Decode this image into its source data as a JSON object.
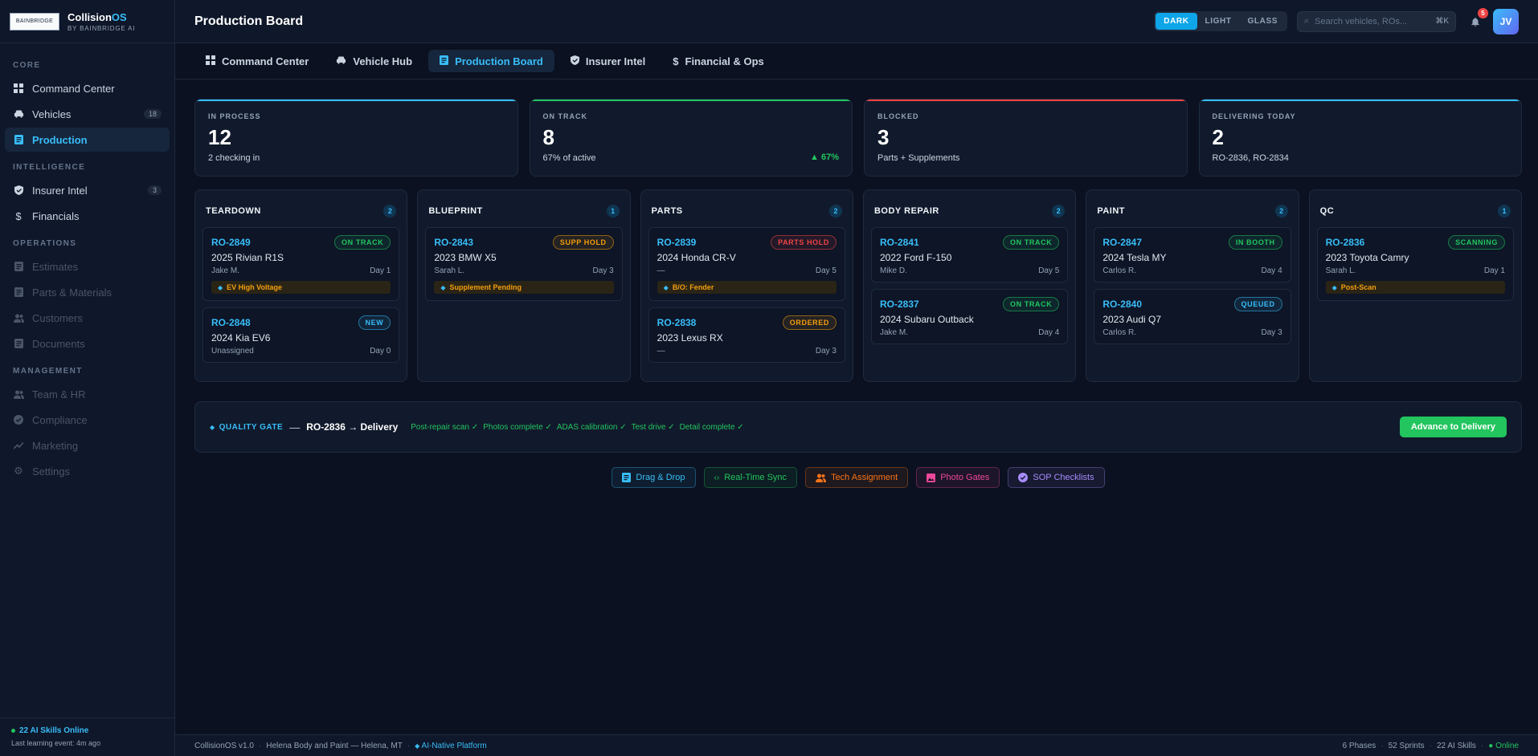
{
  "brand": {
    "logo_text": "BAINBRIDGE",
    "name_a": "Collision",
    "name_b": "OS",
    "sub": "BY BAINBRIDGE AI"
  },
  "sidebar": {
    "sections": [
      {
        "label": "CORE",
        "items": [
          {
            "label": "Command Center",
            "icon": "grid-icon",
            "count": ""
          },
          {
            "label": "Vehicles",
            "icon": "car-icon",
            "count": "18"
          },
          {
            "label": "Production",
            "icon": "board-icon",
            "count": "",
            "active": true
          }
        ]
      },
      {
        "label": "INTELLIGENCE",
        "items": [
          {
            "label": "Insurer Intel",
            "icon": "shield-icon",
            "count": "3"
          },
          {
            "label": "Financials",
            "icon": "dollar-icon",
            "count": ""
          }
        ]
      },
      {
        "label": "OPERATIONS",
        "items": [
          {
            "label": "Estimates",
            "icon": "document-icon",
            "count": "",
            "dim": true
          },
          {
            "label": "Parts & Materials",
            "icon": "document-icon",
            "count": "",
            "dim": true
          },
          {
            "label": "Customers",
            "icon": "users-icon",
            "count": "",
            "dim": true
          },
          {
            "label": "Documents",
            "icon": "document-icon",
            "count": "",
            "dim": true
          }
        ]
      },
      {
        "label": "MANAGEMENT",
        "items": [
          {
            "label": "Team & HR",
            "icon": "users-icon",
            "count": "",
            "dim": true
          },
          {
            "label": "Compliance",
            "icon": "check-circle-icon",
            "count": "",
            "dim": true
          },
          {
            "label": "Marketing",
            "icon": "trend-icon",
            "count": "",
            "dim": true
          },
          {
            "label": "Settings",
            "icon": "gear-icon",
            "count": "",
            "dim": true
          }
        ]
      }
    ],
    "footer": {
      "skills": "22 AI Skills Online",
      "last_event": "Last learning event: 4m ago"
    }
  },
  "topbar": {
    "title": "Production Board",
    "themes": [
      "DARK",
      "LIGHT",
      "GLASS"
    ],
    "active_theme": "DARK",
    "search_placeholder": "Search vehicles, ROs...",
    "search_shortcut": "⌘K",
    "notification_count": "5",
    "avatar_initials": "JV"
  },
  "tabs": [
    {
      "label": "Command Center",
      "icon": "grid-icon"
    },
    {
      "label": "Vehicle Hub",
      "icon": "car-icon"
    },
    {
      "label": "Production Board",
      "icon": "board-icon",
      "active": true
    },
    {
      "label": "Insurer Intel",
      "icon": "shield-icon"
    },
    {
      "label": "Financial & Ops",
      "icon": "dollar-icon"
    }
  ],
  "stats": [
    {
      "label": "IN PROCESS",
      "value": "12",
      "sub": "2 checking in",
      "trend": "",
      "color": "#38bdf8"
    },
    {
      "label": "ON TRACK",
      "value": "8",
      "sub": "67% of active",
      "trend": "▲ 67%",
      "color": "#22c55e"
    },
    {
      "label": "BLOCKED",
      "value": "3",
      "sub": "Parts + Supplements",
      "trend": "",
      "color": "#ef4444"
    },
    {
      "label": "DELIVERING TODAY",
      "value": "2",
      "sub": "RO-2836, RO-2834",
      "trend": "",
      "color": "#38bdf8"
    }
  ],
  "columns": [
    {
      "name": "TEARDOWN",
      "count": "2",
      "cards": [
        {
          "ro": "RO-2849",
          "status": "ON TRACK",
          "status_color": "#22c55e",
          "vehicle": "2025 Rivian R1S",
          "tech": "Jake M.",
          "day": "Day 1",
          "tag": "EV High Voltage"
        },
        {
          "ro": "RO-2848",
          "status": "NEW",
          "status_color": "#38bdf8",
          "vehicle": "2024 Kia EV6",
          "tech": "Unassigned",
          "day": "Day 0",
          "tag": ""
        }
      ]
    },
    {
      "name": "BLUEPRINT",
      "count": "1",
      "cards": [
        {
          "ro": "RO-2843",
          "status": "SUPP HOLD",
          "status_color": "#f59e0b",
          "vehicle": "2023 BMW X5",
          "tech": "Sarah L.",
          "day": "Day 3",
          "tag": "Supplement Pending"
        }
      ]
    },
    {
      "name": "PARTS",
      "count": "2",
      "cards": [
        {
          "ro": "RO-2839",
          "status": "PARTS HOLD",
          "status_color": "#ef4444",
          "vehicle": "2024 Honda CR-V",
          "tech": "—",
          "day": "Day 5",
          "tag": "B/O: Fender"
        },
        {
          "ro": "RO-2838",
          "status": "ORDERED",
          "status_color": "#f59e0b",
          "vehicle": "2023 Lexus RX",
          "tech": "—",
          "day": "Day 3",
          "tag": ""
        }
      ]
    },
    {
      "name": "BODY REPAIR",
      "count": "2",
      "cards": [
        {
          "ro": "RO-2841",
          "status": "ON TRACK",
          "status_color": "#22c55e",
          "vehicle": "2022 Ford F-150",
          "tech": "Mike D.",
          "day": "Day 5",
          "tag": ""
        },
        {
          "ro": "RO-2837",
          "status": "ON TRACK",
          "status_color": "#22c55e",
          "vehicle": "2024 Subaru Outback",
          "tech": "Jake M.",
          "day": "Day 4",
          "tag": ""
        }
      ]
    },
    {
      "name": "PAINT",
      "count": "2",
      "cards": [
        {
          "ro": "RO-2847",
          "status": "IN BOOTH",
          "status_color": "#22c55e",
          "vehicle": "2024 Tesla MY",
          "tech": "Carlos R.",
          "day": "Day 4",
          "tag": ""
        },
        {
          "ro": "RO-2840",
          "status": "QUEUED",
          "status_color": "#38bdf8",
          "vehicle": "2023 Audi Q7",
          "tech": "Carlos R.",
          "day": "Day 3",
          "tag": ""
        }
      ]
    },
    {
      "name": "QC",
      "count": "1",
      "cards": [
        {
          "ro": "RO-2836",
          "status": "SCANNING",
          "status_color": "#22c55e",
          "vehicle": "2023 Toyota Camry",
          "tech": "Sarah L.",
          "day": "Day 1",
          "tag": "Post-Scan"
        }
      ]
    }
  ],
  "quality_gate": {
    "label": "QUALITY GATE",
    "dash": "—",
    "target": "RO-2836 → Delivery",
    "checks": [
      "Post-repair scan ✓",
      "Photos complete ✓",
      "ADAS calibration ✓",
      "Test drive ✓",
      "Detail complete ✓"
    ],
    "button": "Advance to Delivery"
  },
  "features": [
    {
      "label": "Drag & Drop",
      "icon": "board-icon",
      "color": "#38bdf8"
    },
    {
      "label": "Real-Time Sync",
      "icon": "code-icon",
      "color": "#22c55e"
    },
    {
      "label": "Tech Assignment",
      "icon": "users-icon",
      "color": "#f97316"
    },
    {
      "label": "Photo Gates",
      "icon": "image-icon",
      "color": "#ec4899"
    },
    {
      "label": "SOP Checklists",
      "icon": "check-circle-icon",
      "color": "#a78bfa"
    }
  ],
  "footer": {
    "version": "CollisionOS v1.0",
    "shop": "Helena Body and Paint — Helena, MT",
    "platform": "AI-Native Platform",
    "phases": "6 Phases",
    "sprints": "52 Sprints",
    "skills": "22 AI Skills",
    "status": "● Online"
  }
}
